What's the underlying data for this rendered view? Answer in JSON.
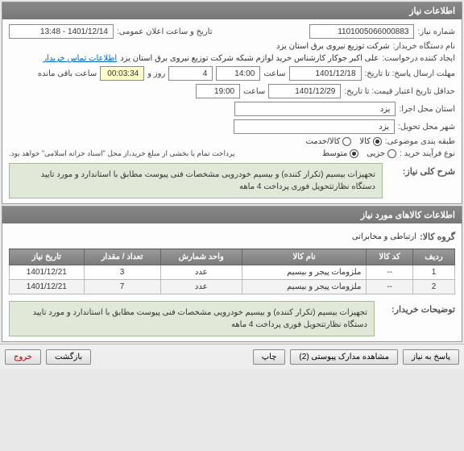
{
  "panel1": {
    "title": "اطلاعات نیاز",
    "need_no_label": "شماره نیاز:",
    "need_no": "1101005066000883",
    "announce_label": "تاریخ و ساعت اعلان عمومی:",
    "announce_value": "1401/12/14 - 13:48",
    "buyer_label": "نام دستگاه خریدار:",
    "buyer_value": "شرکت توزیع نیروی برق استان یزد",
    "creator_label": "ایجاد کننده درخواست:",
    "creator_value": "علی اکبر جوکار  کارشناس خرید لوازم شبکه  شرکت توزیع نیروی برق استان یزد",
    "contact_link": "اطلاعات تماس خریدار",
    "reply_deadline_label": "مهلت ارسال پاسخ: تا تاریخ:",
    "reply_date": "1401/12/18",
    "time_label": "ساعت",
    "reply_time": "14:00",
    "day_and": "روز و",
    "day_count": "4",
    "remaining_time": "00:03:34",
    "remaining_label": "ساعت باقی مانده",
    "validity_label": "حداقل تاریخ اعتبار قیمت: تا تاریخ:",
    "validity_date": "1401/12/29",
    "validity_time": "19:00",
    "exec_province_label": "استان محل اجرا:",
    "exec_province": "یزد",
    "delivery_city_label": "شهر محل تحویل:",
    "delivery_city": "یزد",
    "grouping_label": "طبقه بندی موضوعی:",
    "grouping_options": {
      "goods": "کالا",
      "service": "کالا/خدمت"
    },
    "process_label": "نوع فرآیند خرید :",
    "process_options": {
      "small": "جزیی",
      "medium": "متوسط"
    },
    "payment_note": "پرداخت تمام یا بخشی از مبلغ خرید،از محل \"اسناد خزانه اسلامی\" خواهد بود.",
    "summary_label": "شرح کلی نیاز:",
    "summary_text": "تجهیزات بیسیم (تکرار کننده) و بیسیم خودرویی مشخصات فنی  پیوست مطابق با استاندارد و مورد تایید دستگاه نظارتتحویل فوری پرداخت 4 ماهه"
  },
  "panel2": {
    "title": "اطلاعات کالاهای مورد نیاز",
    "group_label": "گروه کالا:",
    "group_value": "ارتباطی و مخابراتی",
    "table": {
      "headers": {
        "row": "ردیف",
        "code": "کد کالا",
        "name": "نام کالا",
        "unit": "واحد شمارش",
        "qty": "تعداد / مقدار",
        "date": "تاریخ نیاز"
      },
      "rows": [
        {
          "row": "1",
          "code": "--",
          "name": "ملزومات پیجر و بیسیم",
          "unit": "عدد",
          "qty": "3",
          "date": "1401/12/21"
        },
        {
          "row": "2",
          "code": "--",
          "name": "ملزومات پیجر و بیسیم",
          "unit": "عدد",
          "qty": "7",
          "date": "1401/12/21"
        }
      ]
    },
    "buyer_notes_label": "توضیحات خریدار:",
    "buyer_notes": "تجهیزات بیسیم (تکرار کننده) و بیسیم خودرویی مشخصات فنی  پیوست مطابق با استاندارد و مورد تایید دستگاه نظارتتحویل فوری پرداخت 4 ماهه"
  },
  "buttons": {
    "reply": "پاسخ به نیاز",
    "attachments": "مشاهده مدارک پیوستی (2)",
    "print": "چاپ",
    "back": "بازگشت",
    "exit": "خروج"
  }
}
